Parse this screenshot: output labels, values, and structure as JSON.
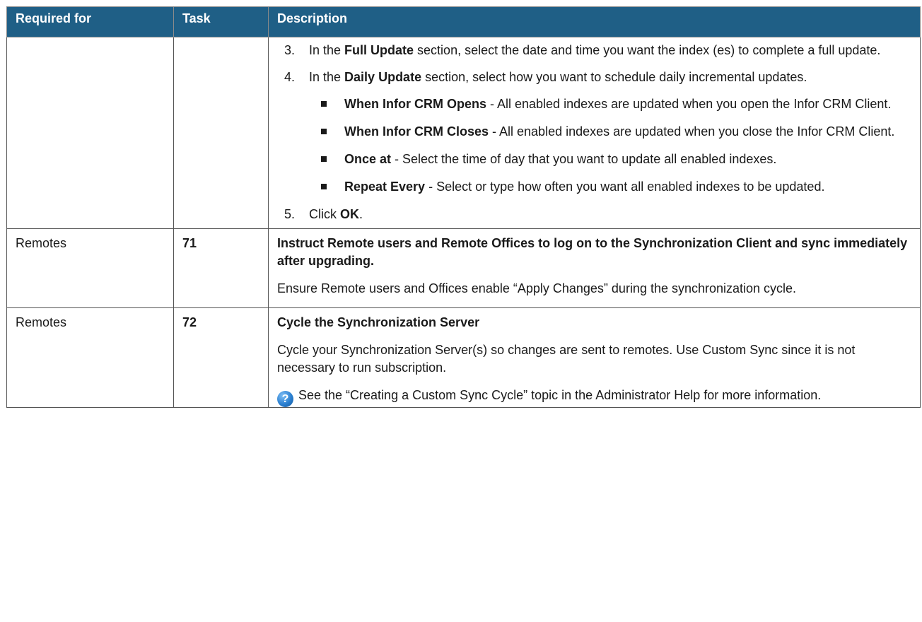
{
  "headers": {
    "required_for": "Required for",
    "task": "Task",
    "description": "Description"
  },
  "row_continued": {
    "steps": [
      {
        "num": "3.",
        "pre": "In the ",
        "bold": "Full Update",
        "post": " section, select the date and time you want the index (es) to complete a full update."
      },
      {
        "num": "4.",
        "pre": "In the ",
        "bold": "Daily Update",
        "post": " section, select how you want to schedule daily incremental updates."
      }
    ],
    "bullets": [
      {
        "bold": "When Infor CRM Opens",
        "post": " - All enabled indexes are updated when you open the Infor CRM Client."
      },
      {
        "bold": "When Infor CRM Closes",
        "post": " - All enabled indexes are updated when you close the Infor CRM Client."
      },
      {
        "bold": "Once at",
        "post": " - Select the time of day that you want to update all enabled indexes."
      },
      {
        "bold": "Repeat Every",
        "post": " - Select or type how often you want all enabled indexes to be updated."
      }
    ],
    "final_step": {
      "num": "5.",
      "pre": "Click ",
      "bold": "OK",
      "post": "."
    }
  },
  "row_71": {
    "required_for": "Remotes",
    "task": "71",
    "title": "Instruct Remote users and Remote Offices to log on to the Synchronization Client and sync immediately after upgrading.",
    "body": "Ensure Remote users and Offices enable “Apply Changes” during the synchronization cycle."
  },
  "row_72": {
    "required_for": "Remotes",
    "task": "72",
    "title": "Cycle the Synchronization Server",
    "body": "Cycle your Synchronization Server(s) so changes are sent to remotes. Use Custom Sync since it is not necessary to run subscription.",
    "help_icon_glyph": "?",
    "help_icon": "help-question-icon",
    "note": " See the “Creating a Custom Sync Cycle” topic in the Administrator Help for more information."
  }
}
